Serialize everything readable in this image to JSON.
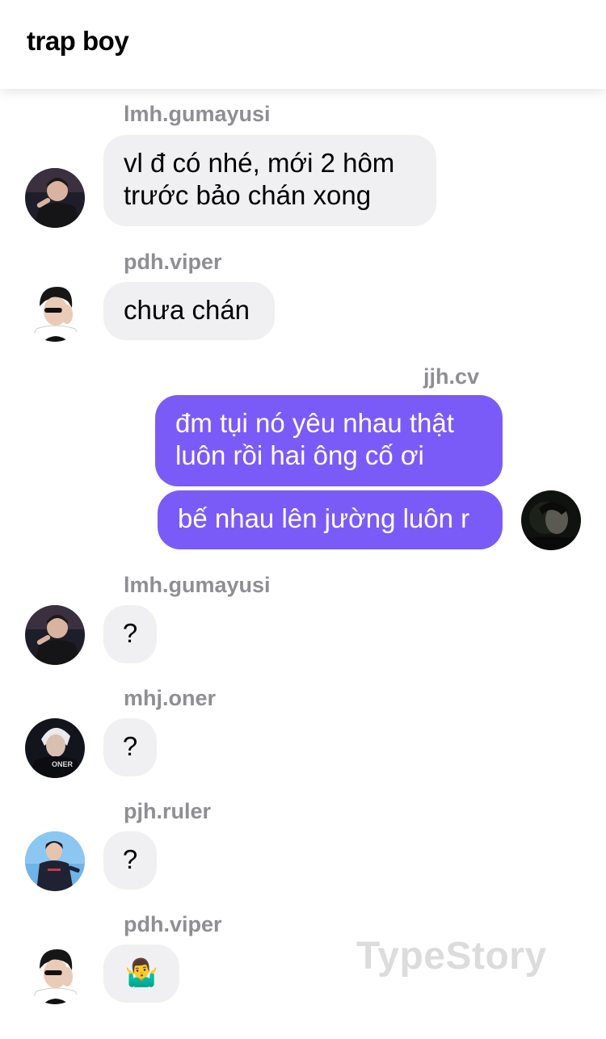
{
  "header": {
    "title": "trap boy"
  },
  "messages": [
    {
      "sender": "lmh.gumayusi",
      "text": "vl đ có nhé, mới 2 hôm\ntrước bảo chán xong"
    },
    {
      "sender": "pdh.viper",
      "text": "chưa chán"
    },
    {
      "sender": "jjh.cv",
      "texts": [
        "đm tụi nó yêu nhau thật\nluôn rồi hai ông cố ơi",
        "bế nhau lên jường luôn r"
      ]
    },
    {
      "sender": "lmh.gumayusi",
      "text": "?"
    },
    {
      "sender": "mhj.oner",
      "text": "?"
    },
    {
      "sender": "pjh.ruler",
      "text": "?"
    },
    {
      "sender": "pdh.viper",
      "text": "🤷‍♂️"
    }
  ],
  "avatar_texts": {
    "oner_jersey": "ONER"
  },
  "watermark": "TypeStory",
  "colors": {
    "sent_bubble": "#7b5bf7",
    "received_bubble": "#f0f0f2",
    "sender_name": "#8e8e93"
  }
}
